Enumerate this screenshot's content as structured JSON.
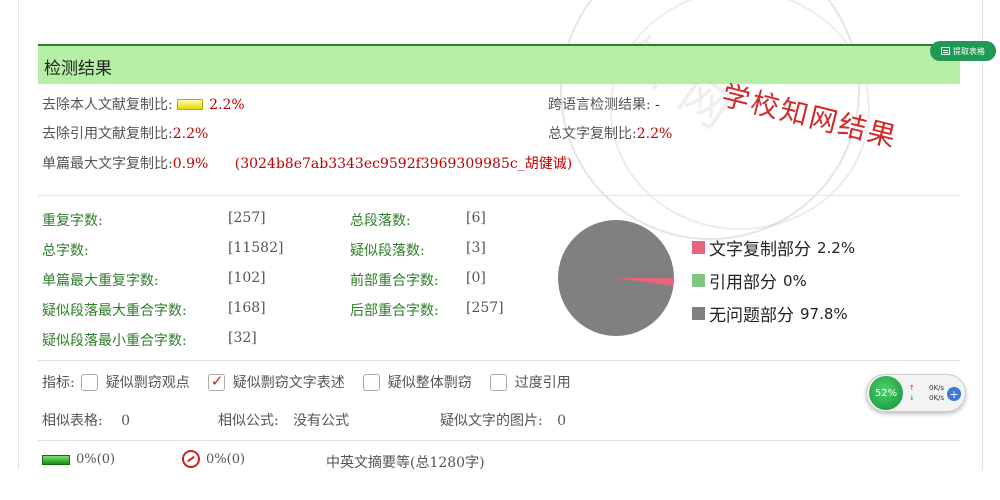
{
  "header": {
    "title": "检测结果",
    "extract_button": "提取表格"
  },
  "summary": {
    "self_copy_label": "去除本人文献复制比:",
    "self_copy_value": "2.2%",
    "cross_lang_label": "跨语言检测结果:",
    "cross_lang_value": "-",
    "cite_copy_label": "去除引用文献复制比:",
    "cite_copy_value": "2.2%",
    "total_copy_label": "总文字复制比:",
    "total_copy_value": "2.2%",
    "max_single_label": "单篇最大文字复制比:",
    "max_single_value": "0.9%",
    "max_single_source": "(3024b8e7ab3343ec9592f3969309985c_胡健诚)"
  },
  "stamp": "学校知网结果",
  "stats": {
    "repeat_chars_label": "重复字数:",
    "repeat_chars_value": "[257]",
    "total_chars_label": "总字数:",
    "total_chars_value": "[11582]",
    "max_single_repeat_label": "单篇最大重复字数:",
    "max_single_repeat_value": "[102]",
    "suspect_para_max_label": "疑似段落最大重合字数:",
    "suspect_para_max_value": "[168]",
    "suspect_para_min_label": "疑似段落最小重合字数:",
    "suspect_para_min_value": "[32]",
    "total_paras_label": "总段落数:",
    "total_paras_value": "[6]",
    "suspect_paras_label": "疑似段落数:",
    "suspect_paras_value": "[3]",
    "front_overlap_label": "前部重合字数:",
    "front_overlap_value": "[0]",
    "back_overlap_label": "后部重合字数:",
    "back_overlap_value": "[257]"
  },
  "chart_data": {
    "type": "pie",
    "categories": [
      "文字复制部分",
      "引用部分",
      "无问题部分"
    ],
    "values": [
      2.2,
      0,
      97.8
    ],
    "labels": [
      "2.2%",
      "0%",
      "97.8%"
    ],
    "colors": [
      "#e8647c",
      "#7fc77f",
      "#808080"
    ],
    "legend": "right"
  },
  "filters": {
    "label": "指标:",
    "options": [
      {
        "label": "疑似剽窃观点",
        "checked": false
      },
      {
        "label": "疑似剽窃文字表述",
        "checked": true
      },
      {
        "label": "疑似整体剽窃",
        "checked": false
      },
      {
        "label": "过度引用",
        "checked": false
      }
    ]
  },
  "info": {
    "similar_tables_label": "相似表格:",
    "similar_tables_value": "0",
    "similar_formula_label": "相似公式:",
    "similar_formula_value": "没有公式",
    "suspect_images_label": "疑似文字的图片:",
    "suspect_images_value": "0"
  },
  "footer": {
    "green_value": "0%(0)",
    "red_value": "0%(0)",
    "section_title": "中英文摘要等(总1280字)"
  },
  "net_widget": {
    "percent": "52%",
    "up_speed": "0K/s",
    "down_speed": "0K/s",
    "up_arrow": "↑",
    "down_arrow": "↓",
    "plus": "+"
  },
  "watermark": "知网"
}
